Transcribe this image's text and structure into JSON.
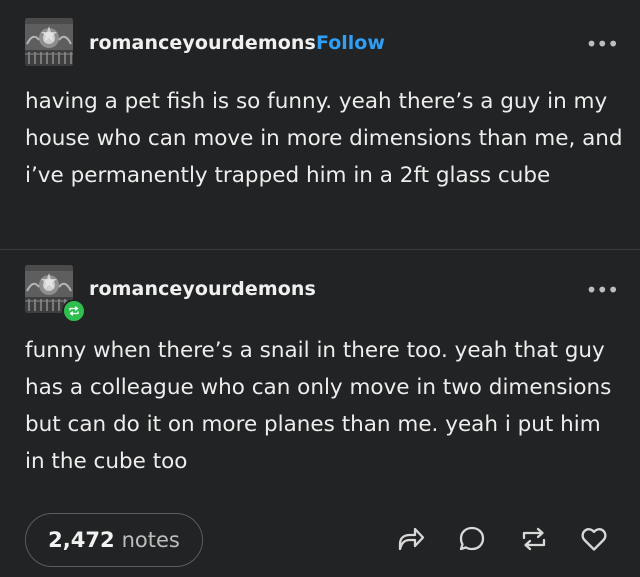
{
  "posts": [
    {
      "username": "romanceyourdemons",
      "follow_label": "Follow",
      "more_label": "•••",
      "text": "having a pet fish is so funny. yeah there’s a guy in my house who can move in more dimensions than me, and i’ve permanently trapped him in a 2ft glass cube"
    },
    {
      "username": "romanceyourdemons",
      "more_label": "•••",
      "text": "funny when there’s a snail in there too. yeah that guy has a colleague who can only move in two dimensions but can do it on more planes than me. yeah i put him in the cube too"
    }
  ],
  "footer": {
    "notes_count": "2,472",
    "notes_label": "notes",
    "actions": [
      "share-icon",
      "reply-icon",
      "reblog-icon",
      "like-icon"
    ]
  },
  "colors": {
    "background": "#222324",
    "follow": "#2f9ef4",
    "reblog_badge": "#2fbf4f"
  }
}
